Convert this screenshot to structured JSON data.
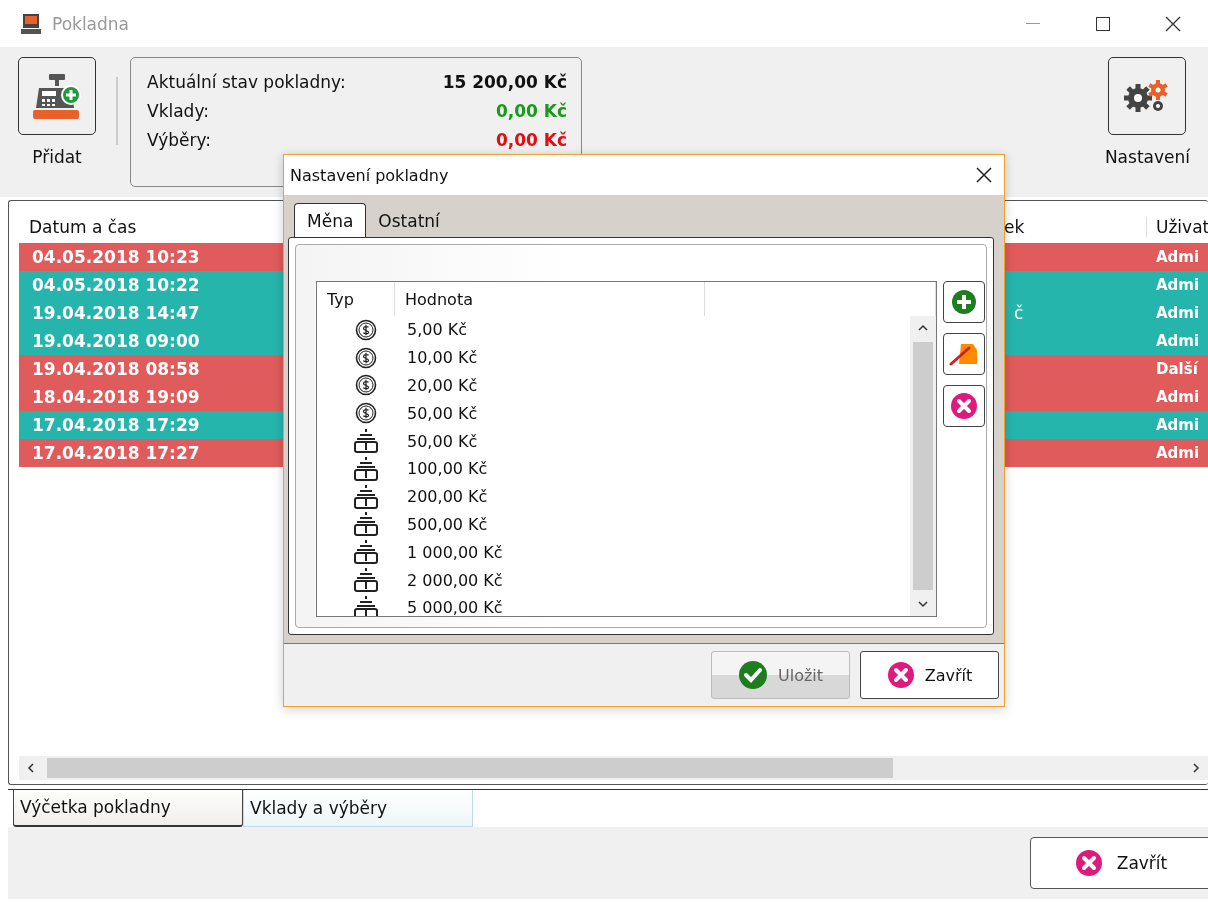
{
  "window": {
    "title": "Pokladna"
  },
  "toolbar": {
    "add_label": "Přidat",
    "settings_label": "Nastavení"
  },
  "summary": [
    {
      "label": "Aktuální stav pokladny:",
      "value": "15 200,00 Kč",
      "kind": "total"
    },
    {
      "label": "Vklady:",
      "value": "0,00 Kč",
      "kind": "deposit"
    },
    {
      "label": "Výběry:",
      "value": "0,00 Kč",
      "kind": "withdrawal"
    }
  ],
  "table": {
    "columns": [
      "Datum a čas",
      "ek",
      "Uživat"
    ],
    "rows": [
      {
        "date": "04.05.2018 10:23",
        "user": "Admi",
        "color": "#e05c5c"
      },
      {
        "date": "04.05.2018 10:22",
        "user": "Admi",
        "color": "#26b5ad"
      },
      {
        "date": "19.04.2018 14:47",
        "column_3": "č",
        "user": "Admi",
        "color": "#26b5ad"
      },
      {
        "date": "19.04.2018 09:00",
        "user": "Admi",
        "color": "#26b5ad"
      },
      {
        "date": "19.04.2018 08:58",
        "user": "Další",
        "color": "#e05c5c"
      },
      {
        "date": "18.04.2018 19:09",
        "user": "Admi",
        "color": "#e05c5c"
      },
      {
        "date": "17.04.2018 17:29",
        "user": "Admi",
        "color": "#26b5ad"
      },
      {
        "date": "17.04.2018 17:27",
        "user": "Admi",
        "color": "#e05c5c"
      }
    ]
  },
  "bottom_tabs": [
    {
      "label": "Výčetka pokladny",
      "selected": true
    },
    {
      "label": "Vklady a výběry",
      "selected": false
    }
  ],
  "close_button": "Zavřít",
  "dialog": {
    "title": "Nastavení pokladny",
    "tabs": [
      {
        "label": "Měna",
        "selected": true
      },
      {
        "label": "Ostatní",
        "selected": false
      }
    ],
    "columns": [
      "Typ",
      "Hodnota"
    ],
    "rows": [
      {
        "kind": "coin",
        "value": "5,00 Kč"
      },
      {
        "kind": "coin",
        "value": "10,00 Kč"
      },
      {
        "kind": "coin",
        "value": "20,00 Kč"
      },
      {
        "kind": "coin",
        "value": "50,00 Kč"
      },
      {
        "kind": "note",
        "value": "50,00 Kč"
      },
      {
        "kind": "note",
        "value": "100,00 Kč"
      },
      {
        "kind": "note",
        "value": "200,00 Kč"
      },
      {
        "kind": "note",
        "value": "500,00 Kč"
      },
      {
        "kind": "note",
        "value": "1 000,00 Kč"
      },
      {
        "kind": "note",
        "value": "2 000,00 Kč"
      },
      {
        "kind": "note",
        "value": "5 000,00 Kč"
      }
    ],
    "buttons": [
      {
        "label": "Uložit",
        "kind": "save",
        "disabled": true
      },
      {
        "label": "Zavřít",
        "kind": "close",
        "disabled": false
      }
    ]
  }
}
